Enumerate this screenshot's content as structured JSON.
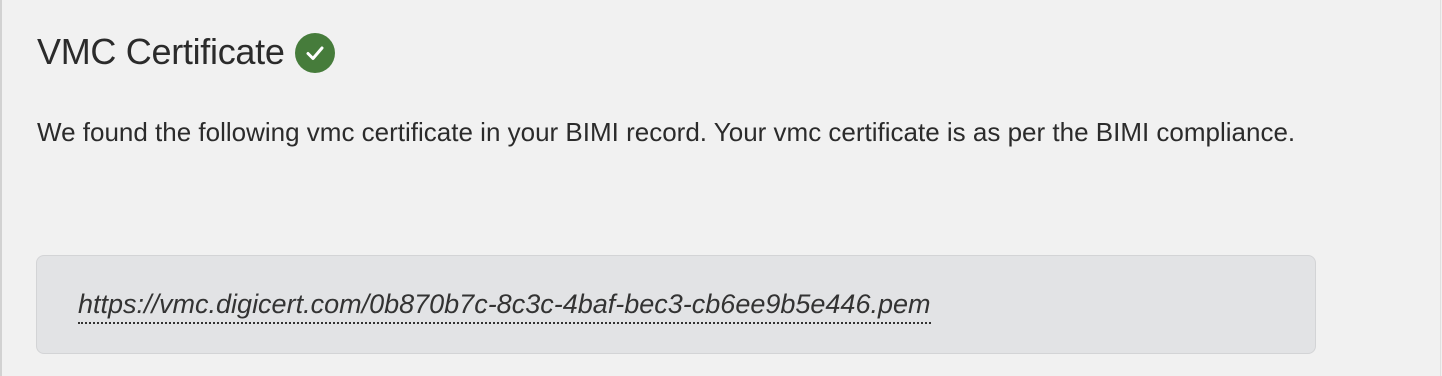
{
  "header": {
    "title": "VMC Certificate",
    "status_icon": "check-circle-icon",
    "status_color": "#467c3b"
  },
  "description": "We found the following vmc certificate in your BIMI record. Your vmc certificate is as per the BIMI compliance.",
  "certificate": {
    "url": "https://vmc.digicert.com/0b870b7c-8c3c-4baf-bec3-cb6ee9b5e446.pem"
  },
  "colors": {
    "background": "#f1f1f1",
    "url_box_background": "#e2e3e5",
    "text": "#2b2b2b"
  }
}
